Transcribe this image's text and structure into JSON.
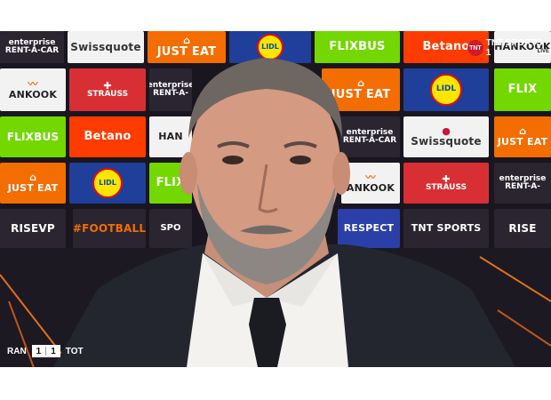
{
  "board": {
    "enterprise": "enterprise",
    "rent_a_car": "RENT-A-CAR",
    "rent_a_short": "RENT-A-",
    "swissquote": "Swissquote",
    "just_eat": "JUST EAT",
    "lidl": "LIDL",
    "flixbus": "FLIXBUS",
    "flix_short": "FLIX",
    "betano": "Betano",
    "hankook": "HANKOOK",
    "hankook_short": "HAN",
    "ankook": "ANKOOK",
    "strauss": "STRAUSS",
    "risevp": "RISEVP",
    "football": "#FOOTBALL",
    "tnt_sports": "TNT SPORTS",
    "respect": "RESPECT",
    "sport_short": "SPO",
    "rise": "RISE"
  },
  "broadcaster": {
    "name": "TNT SPORTS 1",
    "live": "LIVE"
  },
  "scorebug": {
    "home": "RAN",
    "home_score": "1",
    "away_score": "1",
    "away": "TOT"
  },
  "colors": {
    "enterprise": "#1e8b3c",
    "swissquote": "#f2f2f2",
    "just_eat": "#f36d00",
    "lidl": "#0050aa",
    "flixbus": "#73d700",
    "betano": "#ff3c00",
    "hankook": "#f06e1a",
    "strauss": "#d82f35",
    "dark_panel": "#2a2530",
    "respect": "#2a3fa8"
  }
}
